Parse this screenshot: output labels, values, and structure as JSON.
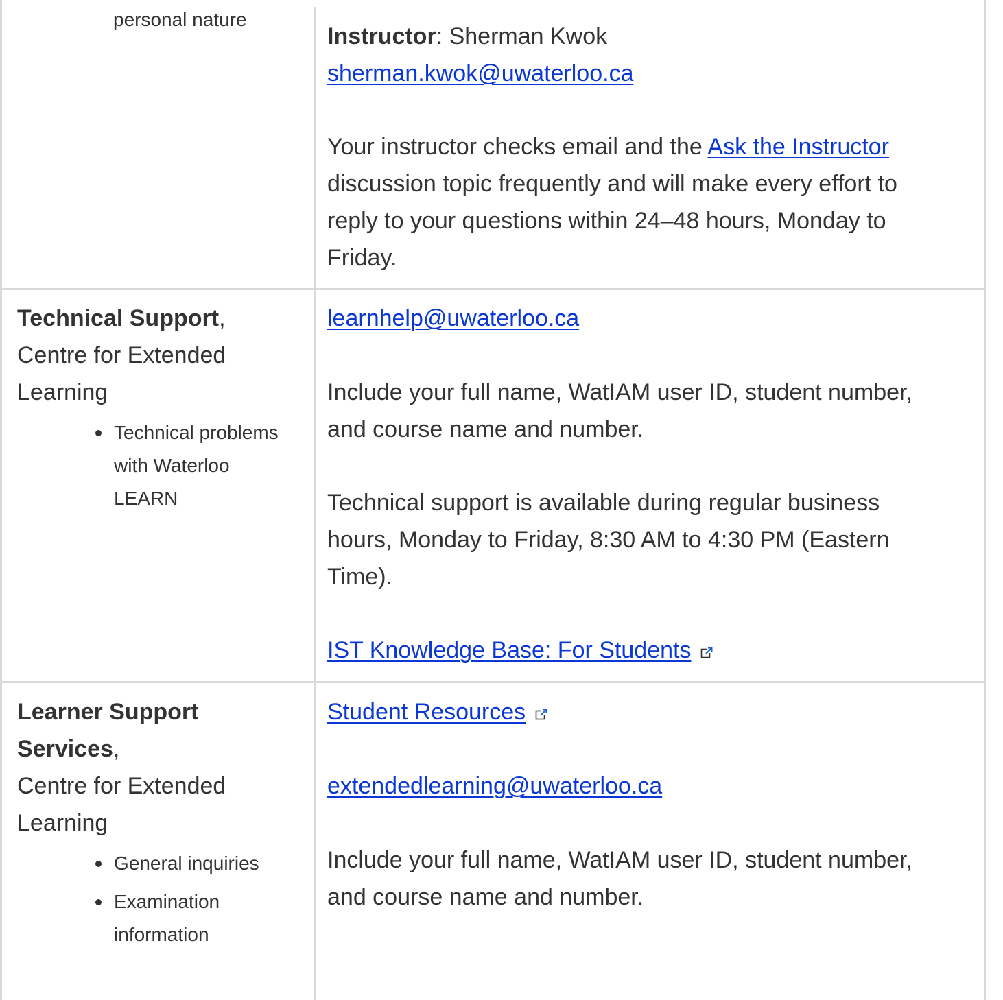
{
  "row_instructor": {
    "left_text": "personal nature",
    "label": "Instructor",
    "name": ": Sherman Kwok",
    "email": "sherman.kwok@uwaterloo.ca",
    "text_before_link": "Your instructor checks email and the ",
    "link": "Ask the Instructor",
    "lines": [
      "discussion topic frequently and will make every effort to",
      "reply to your questions within 24–48 hours, Monday to",
      "Friday."
    ]
  },
  "row_tech": {
    "title": "Technical Support",
    "title_suffix": ",",
    "dept_lines": [
      "Centre for Extended",
      "Learning"
    ],
    "bullet_lines": [
      "Technical problems",
      "with Waterloo",
      "LEARN"
    ],
    "email": "learnhelp@uwaterloo.ca",
    "include_lines": [
      "Include your full name, WatIAM user ID, student number,",
      "and course name and number."
    ],
    "hours_lines": [
      "Technical support is available during regular business",
      "hours, Monday to Friday, 8:30 AM to 4:30 PM (Eastern",
      "Time)."
    ],
    "kb_link": "IST Knowledge Base: For Students"
  },
  "row_learner": {
    "title_lines": [
      "Learner Support",
      "Services"
    ],
    "title_suffix": ",",
    "dept_lines": [
      "Centre for Extended",
      "Learning"
    ],
    "bullets": [
      [
        "General inquiries"
      ],
      [
        "Examination",
        "information"
      ]
    ],
    "resources_link": "Student Resources",
    "email": "extendedlearning@uwaterloo.ca",
    "include_lines": [
      "Include your full name, WatIAM user ID, student number,",
      "and course name and number."
    ]
  },
  "icons": {
    "external_link": "external-link-icon"
  }
}
